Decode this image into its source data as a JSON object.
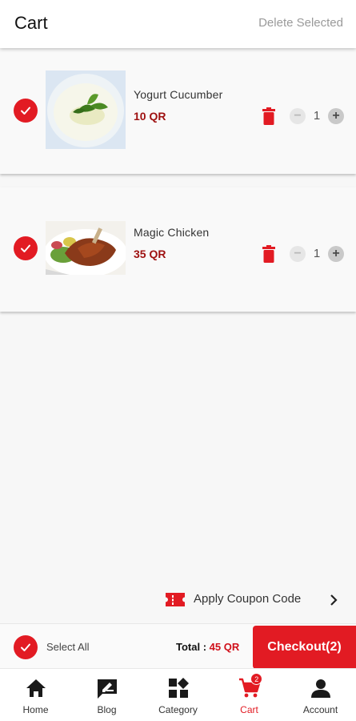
{
  "header": {
    "title": "Cart",
    "delete_selected": "Delete Selected"
  },
  "items": [
    {
      "name": "Yogurt Cucumber",
      "price": "10 QR",
      "quantity": "1",
      "checked": true,
      "thumbnail": "yogurt-cucumber-photo"
    },
    {
      "name": "Magic Chicken",
      "price": "35 QR",
      "quantity": "1",
      "checked": true,
      "thumbnail": "magic-chicken-photo"
    }
  ],
  "coupon": {
    "label": "Apply Coupon Code",
    "icon": "ticket-icon"
  },
  "footer": {
    "select_all": "Select All",
    "total_label": "Total : ",
    "total_value": "45 QR",
    "checkout": "Checkout(2)"
  },
  "nav": {
    "items": [
      {
        "label": "Home",
        "icon": "home-icon"
      },
      {
        "label": "Blog",
        "icon": "blog-icon"
      },
      {
        "label": "Category",
        "icon": "category-icon"
      },
      {
        "label": "Cart",
        "icon": "cart-icon",
        "badge": "2",
        "active": true
      },
      {
        "label": "Account",
        "icon": "account-icon"
      }
    ]
  },
  "colors": {
    "accent": "#e21b23",
    "price": "#9e1010",
    "muted": "#9a9a9a"
  }
}
